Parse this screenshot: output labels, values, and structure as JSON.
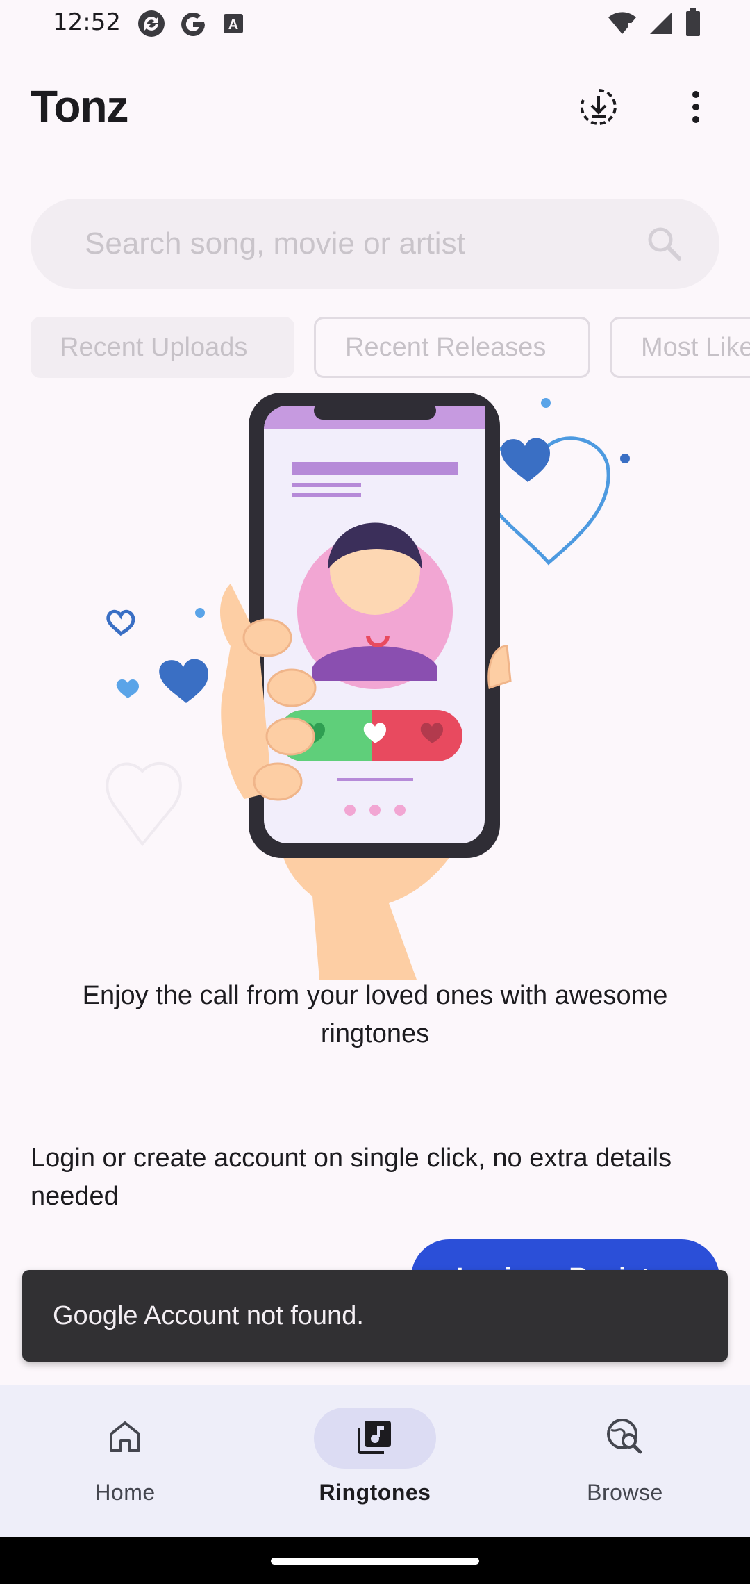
{
  "status_bar": {
    "time": "12:52",
    "left_icons": [
      "sync-icon",
      "google-icon",
      "keyboard-a-icon"
    ],
    "right_icons": [
      "wifi-icon",
      "signal-icon",
      "battery-icon"
    ]
  },
  "app_bar": {
    "title": "Tonz",
    "actions": [
      "download-icon",
      "more-vert-icon"
    ]
  },
  "search": {
    "placeholder": "Search song, movie or artist",
    "value": ""
  },
  "chips": [
    "Recent Uploads",
    "Recent Releases",
    "Most Liked"
  ],
  "tagline": "Enjoy the call from your loved ones with awesome ringtones",
  "login": {
    "description": "Login or create account on single click, no extra details needed",
    "button_label": "Login or Register"
  },
  "snackbar": {
    "message": "Google Account not found."
  },
  "bottom_nav": [
    {
      "label": "Home",
      "icon": "home-icon",
      "active": false
    },
    {
      "label": "Ringtones",
      "icon": "ringtones-icon",
      "active": true
    },
    {
      "label": "Browse",
      "icon": "browse-icon",
      "active": false
    }
  ],
  "colors": {
    "background": "#fcf7fb",
    "accent": "#2b4fd8",
    "snackbar": "#313033",
    "nav_background": "#eeeef9",
    "nav_active_pill": "#dcdcf3"
  }
}
